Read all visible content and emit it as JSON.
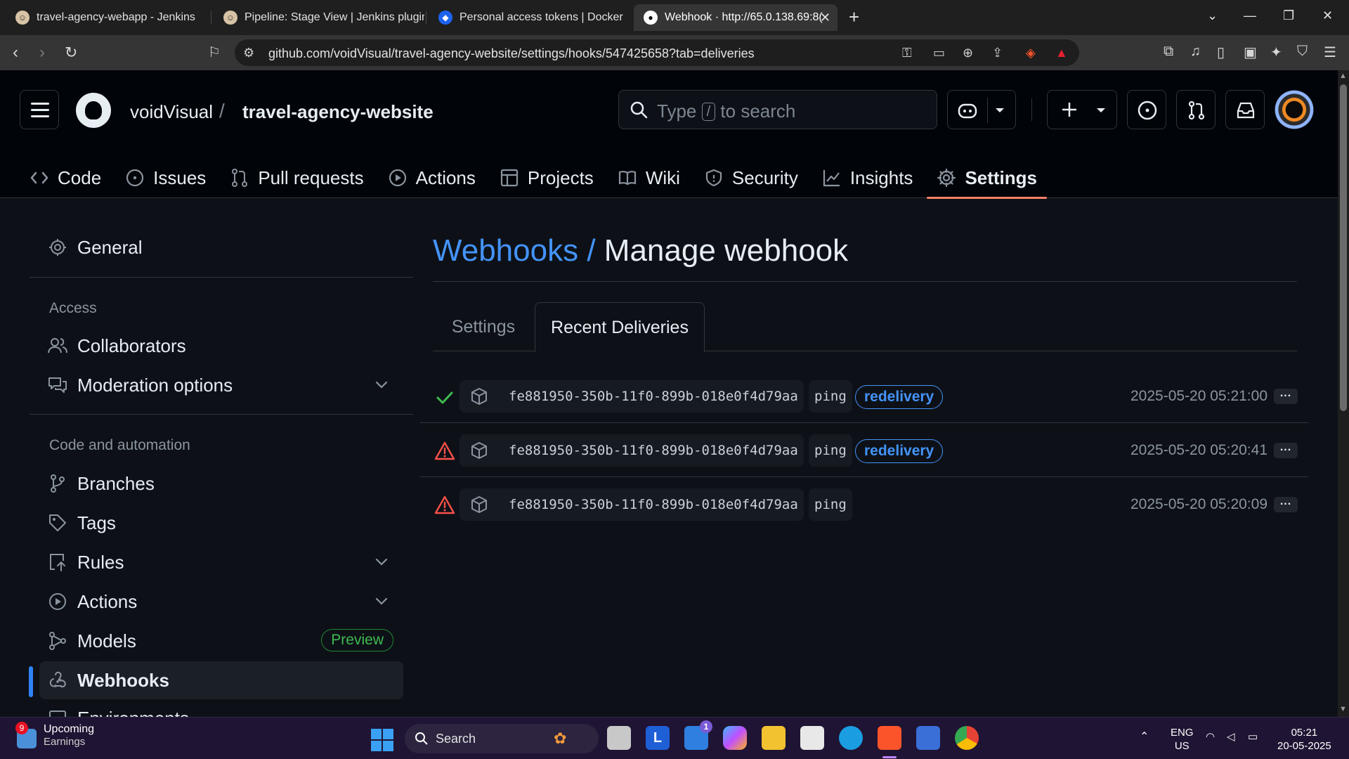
{
  "browser": {
    "tabs": [
      {
        "title": "travel-agency-webapp - Jenkins"
      },
      {
        "title": "Pipeline: Stage View | Jenkins plugin"
      },
      {
        "title": "Personal access tokens | Docker"
      },
      {
        "title": "Webhook · http://65.0.138.69:8("
      }
    ],
    "url": "github.com/voidVisual/travel-agency-website/settings/hooks/547425658?tab=deliveries"
  },
  "header": {
    "owner": "voidVisual",
    "separator": "/",
    "repo": "travel-agency-website",
    "search_prefix": "Type",
    "search_key": "/",
    "search_suffix": "to search"
  },
  "repo_nav": [
    {
      "label": "Code",
      "icon": "code-icon"
    },
    {
      "label": "Issues",
      "icon": "issue-icon"
    },
    {
      "label": "Pull requests",
      "icon": "pull-request-icon"
    },
    {
      "label": "Actions",
      "icon": "play-icon"
    },
    {
      "label": "Projects",
      "icon": "table-icon"
    },
    {
      "label": "Wiki",
      "icon": "book-icon"
    },
    {
      "label": "Security",
      "icon": "shield-icon"
    },
    {
      "label": "Insights",
      "icon": "graph-icon"
    },
    {
      "label": "Settings",
      "icon": "gear-icon",
      "selected": true
    }
  ],
  "sidebar": {
    "general": "General",
    "access_heading": "Access",
    "collaborators": "Collaborators",
    "moderation": "Moderation options",
    "code_heading": "Code and automation",
    "branches": "Branches",
    "tags": "Tags",
    "rules": "Rules",
    "actions": "Actions",
    "models": "Models",
    "models_badge": "Preview",
    "webhooks": "Webhooks",
    "environments": "Environments"
  },
  "main": {
    "breadcrumb_link": "Webhooks",
    "breadcrumb_sep": "/",
    "title": "Manage webhook",
    "tabs": [
      {
        "label": "Settings"
      },
      {
        "label": "Recent Deliveries",
        "selected": true
      }
    ],
    "deliveries": [
      {
        "status": "success",
        "guid": "fe881950-350b-11f0-899b-018e0f4d79aa",
        "event": "ping",
        "badge": "redelivery",
        "time": "2025-05-20 05:21:00"
      },
      {
        "status": "failure",
        "guid": "fe881950-350b-11f0-899b-018e0f4d79aa",
        "event": "ping",
        "badge": "redelivery",
        "time": "2025-05-20 05:20:41"
      },
      {
        "status": "failure",
        "guid": "fe881950-350b-11f0-899b-018e0f4d79aa",
        "event": "ping",
        "badge": "",
        "time": "2025-05-20 05:20:09"
      }
    ],
    "more_label": "..."
  },
  "taskbar": {
    "weather_badge": "9",
    "weather_line1": "Upcoming",
    "weather_line2": "Earnings",
    "search": "Search",
    "app_l": "L",
    "mail_badge": "1",
    "lang": "ENG",
    "region": "US",
    "time": "05:21",
    "date": "20-05-2025"
  },
  "colors": {
    "accent": "#4493f8",
    "selected_underline": "#f78166",
    "success": "#3fb950",
    "danger": "#f85149",
    "bg": "#0d1117"
  }
}
